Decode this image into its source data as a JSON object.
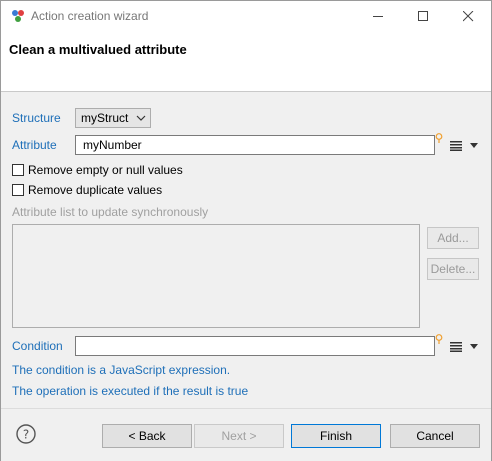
{
  "window": {
    "title": "Action creation wizard"
  },
  "header": {
    "title": "Clean a multivalued attribute"
  },
  "form": {
    "structure_label": "Structure",
    "structure_value": "myStruct",
    "attribute_label": "Attribute",
    "attribute_value": "myNumber",
    "remove_empty_label": "Remove empty or null values",
    "remove_empty_checked": false,
    "remove_duplicates_label": "Remove duplicate values",
    "remove_duplicates_checked": false,
    "sync_list_label": "Attribute list to update synchronously",
    "add_label": "Add...",
    "delete_label": "Delete...",
    "condition_label": "Condition",
    "condition_value": "",
    "info_line1": "The condition is a JavaScript expression.",
    "info_line2": "The operation is executed if the result is true"
  },
  "footer": {
    "back_label": "< Back",
    "next_label": "Next >",
    "finish_label": "Finish",
    "cancel_label": "Cancel"
  },
  "colors": {
    "link": "#1e6fb8",
    "accent": "#0078d7",
    "bulb": "#f0a030"
  },
  "icons": [
    "app-icon",
    "minimize-icon",
    "maximize-icon",
    "close-icon",
    "chevron-down-icon",
    "lightbulb-icon",
    "list-icon",
    "dropdown-arrow-icon",
    "help-icon"
  ]
}
